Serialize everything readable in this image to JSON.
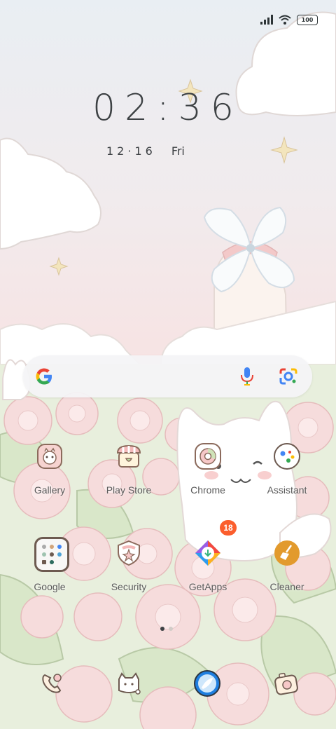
{
  "status_bar": {
    "battery": "100"
  },
  "clock": {
    "time": "02:36",
    "date_digits": "12·16",
    "weekday": "Fri"
  },
  "apps": [
    {
      "label": "Gallery"
    },
    {
      "label": "Play Store"
    },
    {
      "label": "Chrome"
    },
    {
      "label": "Assistant"
    },
    {
      "label": "Google"
    },
    {
      "label": "Security"
    },
    {
      "label": "GetApps"
    },
    {
      "label": "Cleaner"
    }
  ],
  "badges": {
    "getapps": "18"
  },
  "colors": {
    "badge": "#fb5e2d",
    "search_bg": "#f4f4f6",
    "clock_text": "#3d4144"
  }
}
